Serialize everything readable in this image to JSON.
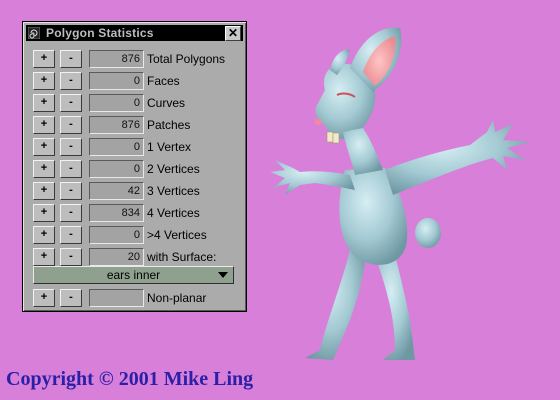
{
  "window": {
    "title": "Polygon Statistics",
    "close_label": "✕"
  },
  "buttons": {
    "plus": "+",
    "minus": "-"
  },
  "rows": [
    {
      "value": "876",
      "label": "Total Polygons"
    },
    {
      "value": "0",
      "label": "Faces"
    },
    {
      "value": "0",
      "label": "Curves"
    },
    {
      "value": "876",
      "label": "Patches"
    },
    {
      "value": "0",
      "label": "1 Vertex"
    },
    {
      "value": "0",
      "label": "2 Vertices"
    },
    {
      "value": "42",
      "label": "3 Vertices"
    },
    {
      "value": "834",
      "label": "4 Vertices"
    },
    {
      "value": "0",
      "label": ">4 Vertices"
    },
    {
      "value": "20",
      "label": "with Surface:"
    }
  ],
  "surface_dropdown": {
    "selected": "ears inner"
  },
  "nonplanar_row": {
    "value": "",
    "label": "Non-planar"
  },
  "copyright": "Copyright © 2001 Mike Ling",
  "colors": {
    "background": "#d77fd9",
    "panel": "#ababab",
    "dropdown": "#8fa08f",
    "rabbit": "#a9cfd8",
    "copyright_text": "#2b1fa6"
  },
  "icons": {
    "app": "swirl-icon",
    "close": "close-icon",
    "dropdown": "chevron-down-icon"
  }
}
